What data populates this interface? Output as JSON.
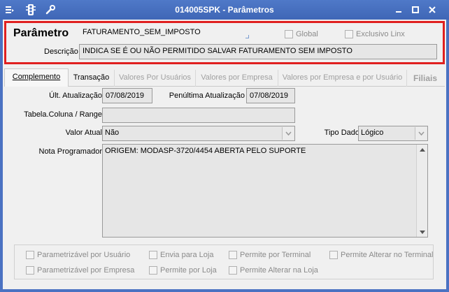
{
  "window": {
    "title": "014005SPK - Parâmetros",
    "controls": [
      "minimize",
      "maximize",
      "close"
    ]
  },
  "header": {
    "parametro_label": "Parâmetro",
    "parametro_value": "FATURAMENTO_SEM_IMPOSTO",
    "global_label": "Global",
    "exclusivo_label": "Exclusivo Linx",
    "descricao_label": "Descrição",
    "descricao_value": "INDICA SE É OU NÃO PERMITIDO SALVAR FATURAMENTO SEM IMPOSTO"
  },
  "tabs": [
    {
      "label": "Complemento",
      "state": "active"
    },
    {
      "label": "Transação",
      "state": "enabled"
    },
    {
      "label": "Valores Por Usuários",
      "state": "disabled"
    },
    {
      "label": "Valores por Empresa",
      "state": "disabled"
    },
    {
      "label": "Valores por Empresa e por Usuário",
      "state": "disabled"
    },
    {
      "label": "Filiais",
      "state": "disabled"
    }
  ],
  "form": {
    "ult_atualizacao_label": "Últ. Atualização",
    "ult_atualizacao_value": "07/08/2019",
    "penultima_label": "Penúltima Atualização",
    "penultima_value": "07/08/2019",
    "tabela_label": "Tabela.Coluna / Range",
    "tabela_value": "",
    "valor_atual_label": "Valor Atual",
    "valor_atual_value": "Não",
    "tipo_dado_label": "Tipo Dado",
    "tipo_dado_value": "Lógico",
    "nota_label": "Nota Programador",
    "nota_value": "ORIGEM: MODASP-3720/4454 ABERTA PELO SUPORTE"
  },
  "options": {
    "parametrizavel_usuario": "Parametrizável por Usuário",
    "envia_loja": "Envia para Loja",
    "permite_terminal": "Permite por Terminal",
    "permite_alterar_terminal": "Permite Alterar no Terminal",
    "parametrizavel_empresa": "Parametrizável por Empresa",
    "permite_loja": "Permite por Loja",
    "permite_alterar_loja": "Permite Alterar na Loja"
  },
  "colors": {
    "titlebar": "#4b72c2",
    "highlight_border": "#e02020"
  }
}
